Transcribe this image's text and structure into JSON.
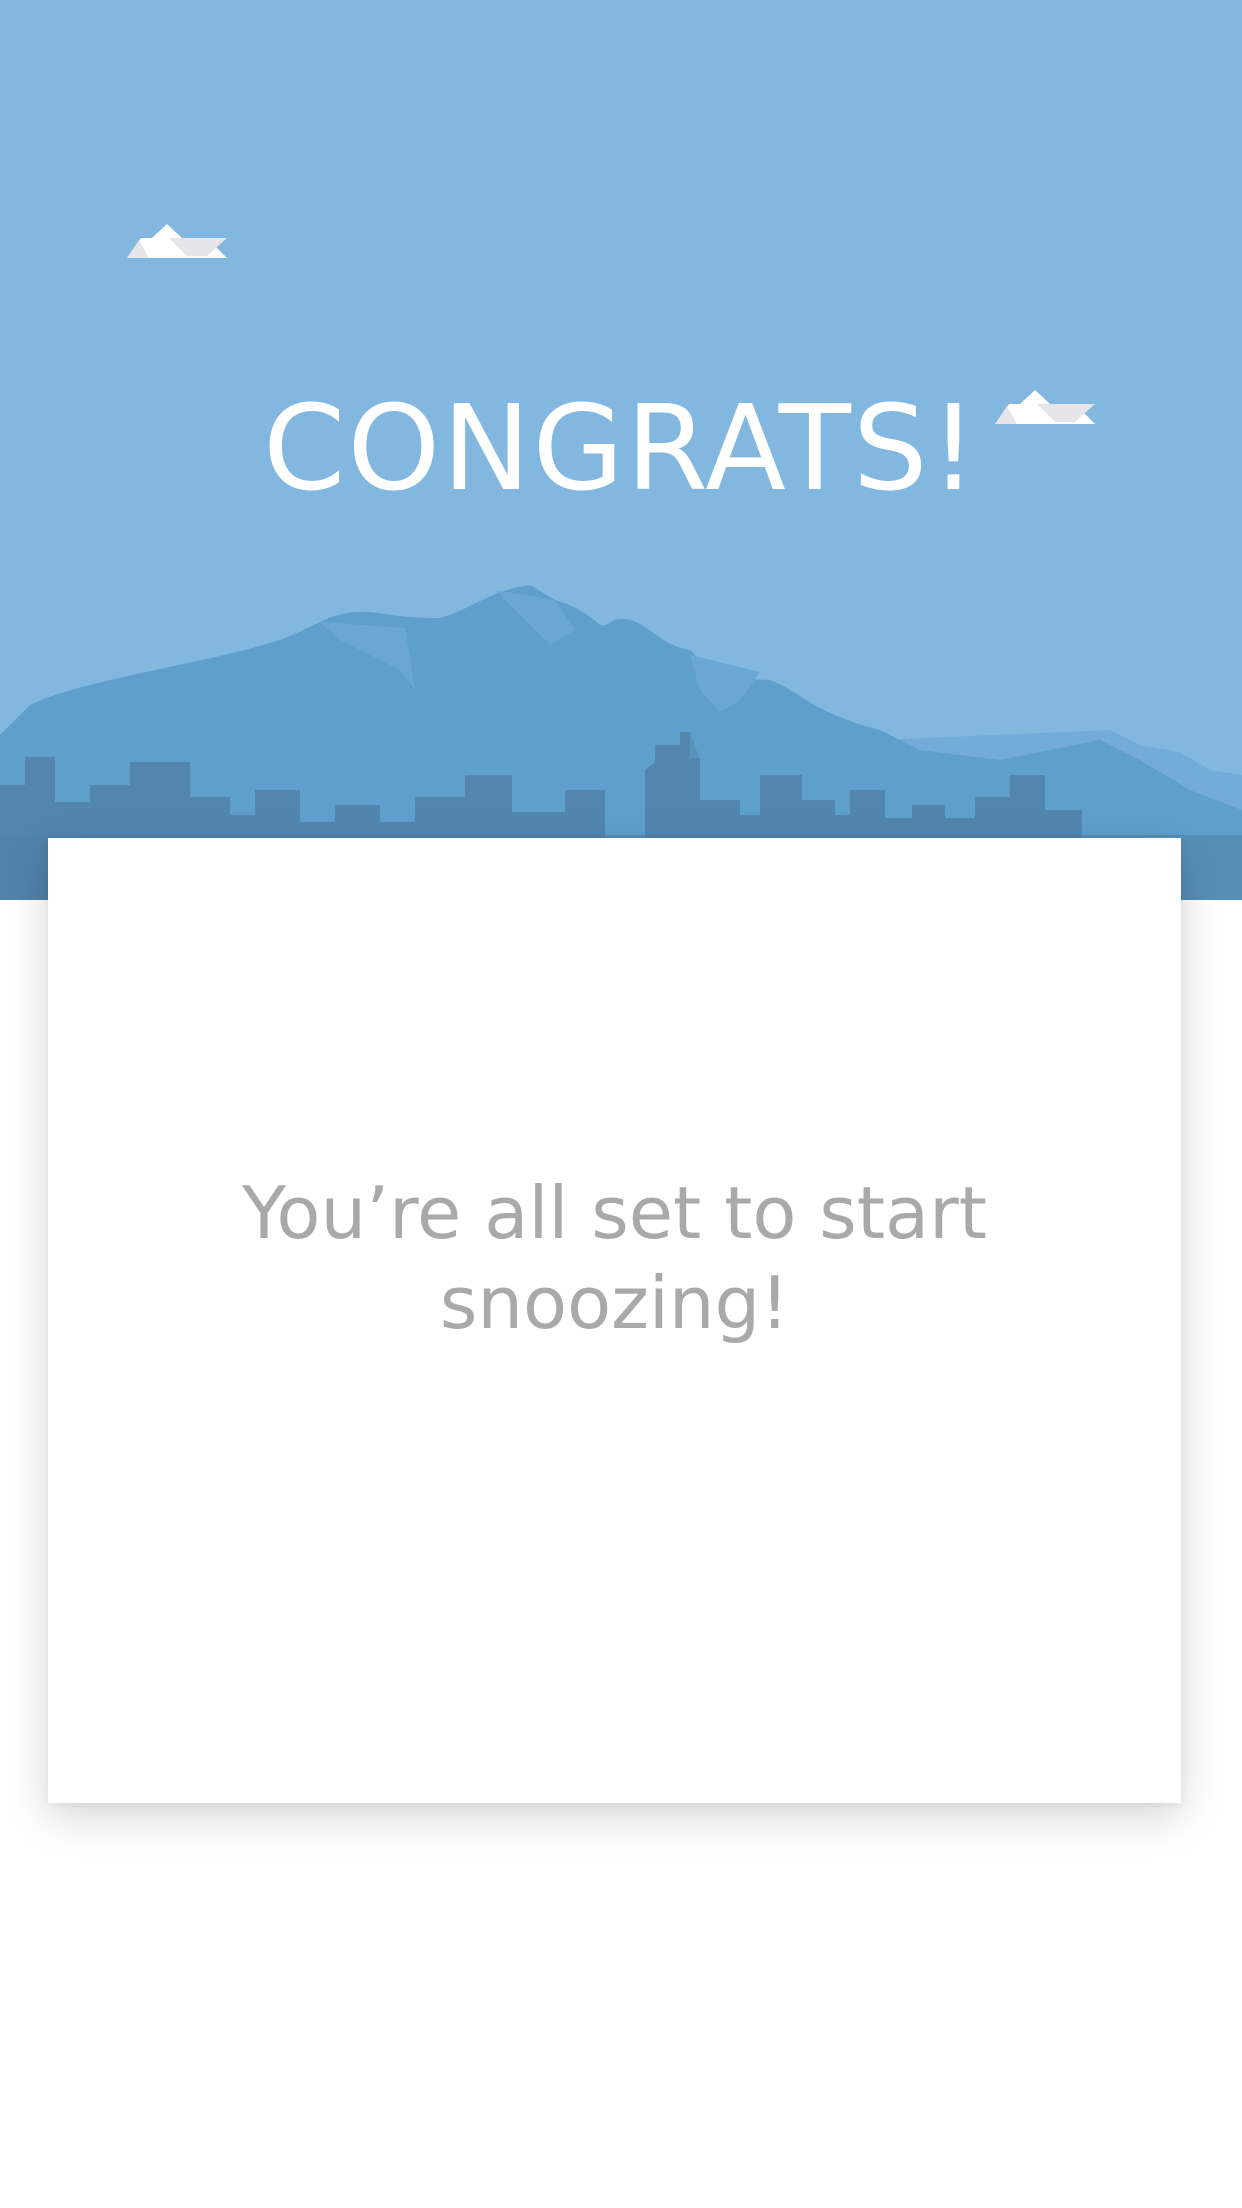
{
  "hero": {
    "title": "CONGRATS!",
    "background_color": "#82b8e0",
    "mountain_color": "#5f9fcc",
    "city_color": "#5185ad"
  },
  "card": {
    "message": "You’re all set to start snoozing!",
    "text_color": "#a9a9a9"
  }
}
